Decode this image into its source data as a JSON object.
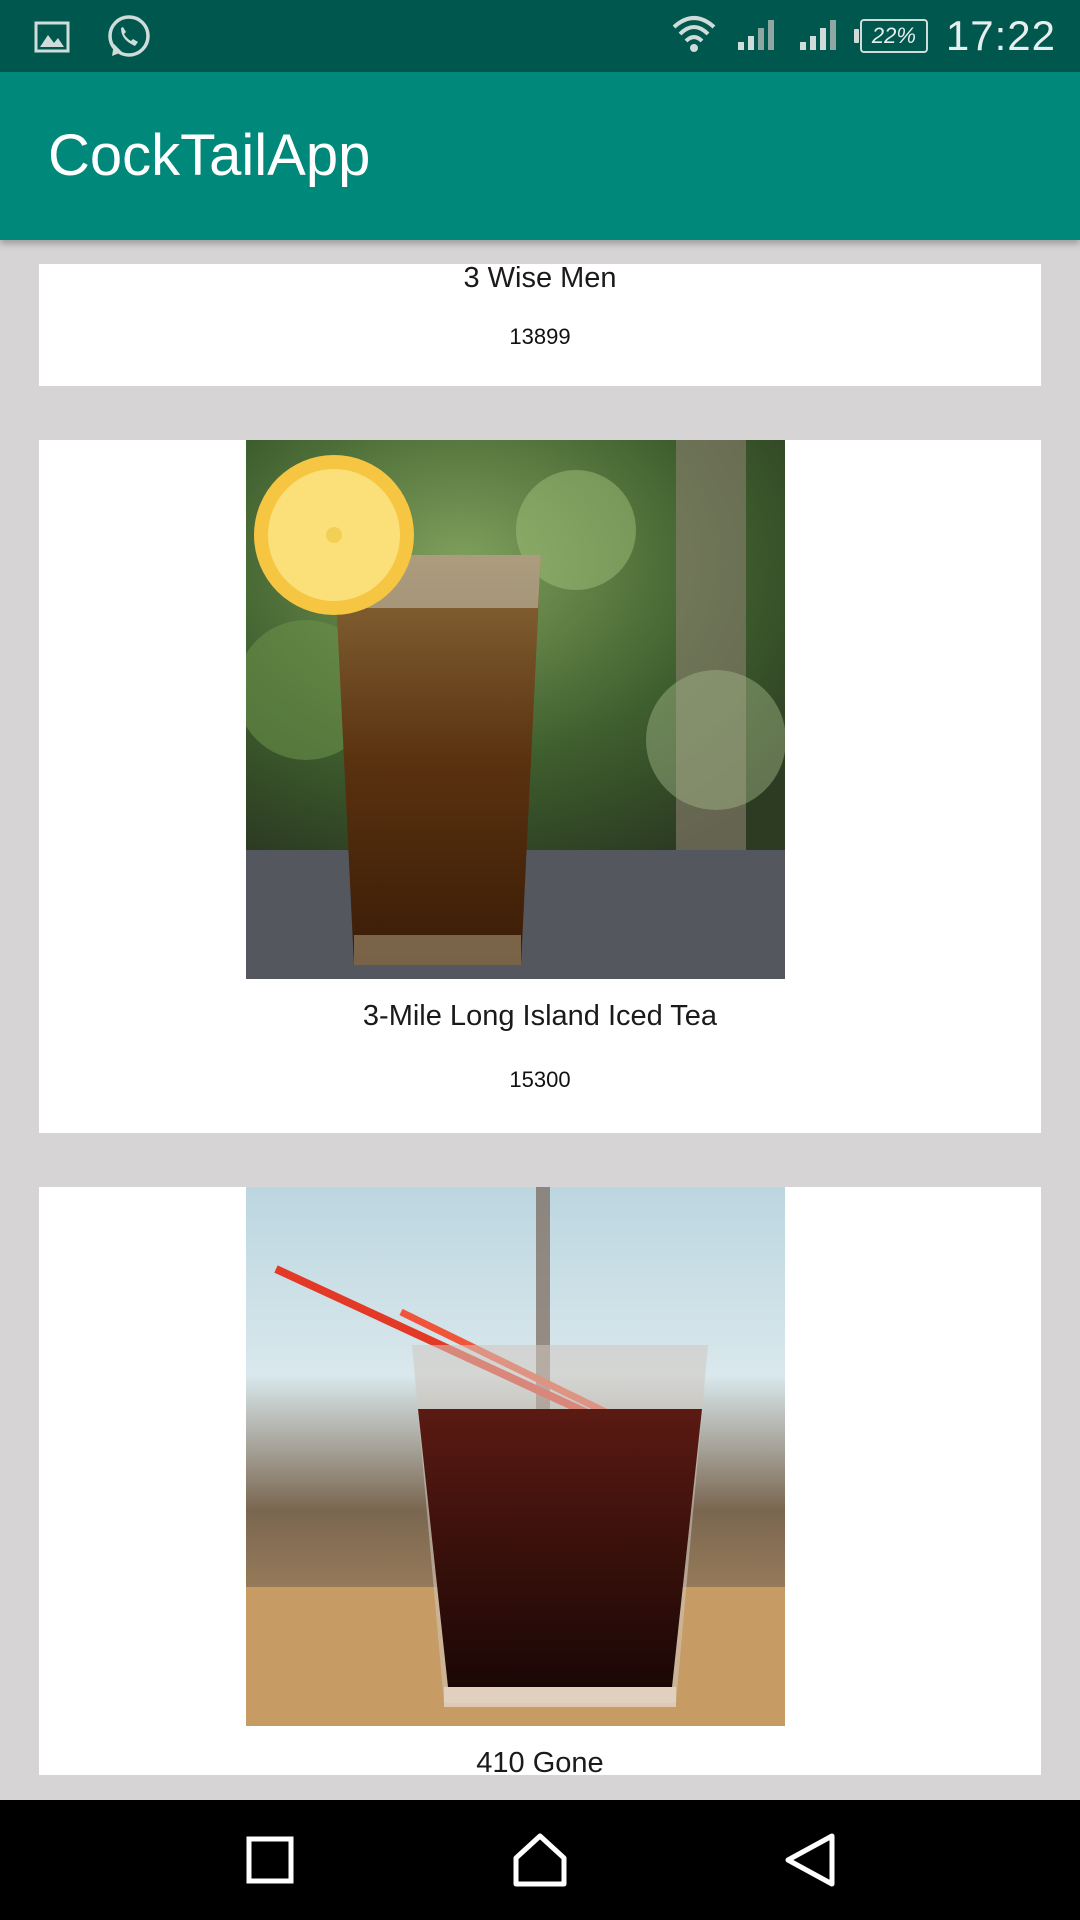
{
  "status_bar": {
    "left_icons": [
      "gallery-icon",
      "whatsapp-icon"
    ],
    "right_icons": [
      "wifi-icon",
      "signal-icon",
      "signal-icon"
    ],
    "battery": "22%",
    "time": "17:22"
  },
  "app_bar": {
    "title": "CockTailApp",
    "color": "#00897b"
  },
  "drinks": [
    {
      "name": "3 Wise Men",
      "id": "13899"
    },
    {
      "name": "3-Mile Long Island Iced Tea",
      "id": "15300",
      "image": "iced-tea-glass-with-lemon"
    },
    {
      "name": "410 Gone",
      "image": "dark-cocktail-glass-with-red-straws"
    }
  ],
  "nav_bar": {
    "buttons": [
      "recents-icon",
      "home-icon",
      "back-icon"
    ]
  }
}
